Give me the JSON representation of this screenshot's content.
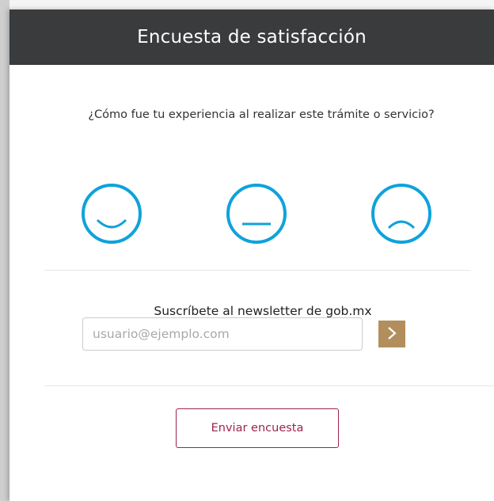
{
  "modal": {
    "title": "Encuesta de satisfacción",
    "question": "¿Cómo fue tu experiencia al realizar este trámite o servicio?",
    "faces": [
      {
        "name": "happy-face-icon",
        "meaning": "good"
      },
      {
        "name": "neutral-face-icon",
        "meaning": "neutral"
      },
      {
        "name": "sad-face-icon",
        "meaning": "bad"
      }
    ],
    "newsletter": {
      "label": "Suscríbete al newsletter de gob.mx",
      "placeholder": "usuario@ejemplo.com",
      "value": "",
      "submit_icon": "chevron-right-icon"
    },
    "send_button_label": "Enviar encuesta"
  },
  "colors": {
    "header_bg": "#393b3d",
    "face_stroke": "#0fa2dc",
    "gold": "#b38e5d",
    "send_button": "#9d2449"
  }
}
